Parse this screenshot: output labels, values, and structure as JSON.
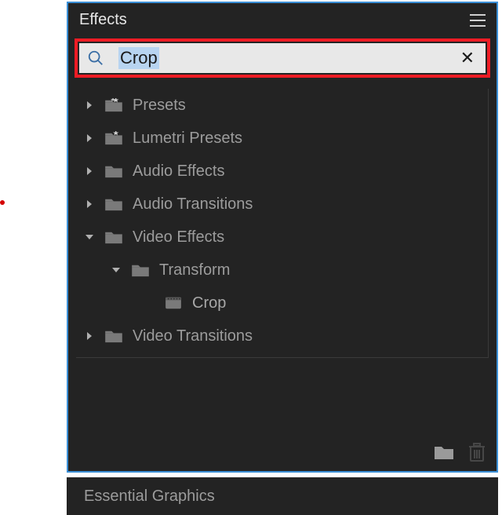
{
  "panel": {
    "title": "Effects"
  },
  "search": {
    "value": "Crop"
  },
  "tree": {
    "items": [
      {
        "label": "Presets"
      },
      {
        "label": "Lumetri Presets"
      },
      {
        "label": "Audio Effects"
      },
      {
        "label": "Audio Transitions"
      },
      {
        "label": "Video Effects"
      },
      {
        "label": "Transform"
      },
      {
        "label": "Crop"
      },
      {
        "label": "Video Transitions"
      }
    ]
  },
  "lower_panel": {
    "title": "Essential Graphics"
  }
}
